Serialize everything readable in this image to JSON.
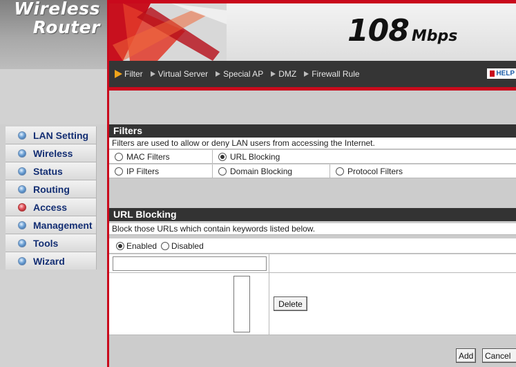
{
  "brand": {
    "line1": "Wireless",
    "line2": "Router"
  },
  "banner": {
    "speed_value": "108",
    "speed_unit": "Mbps"
  },
  "nav": {
    "items": [
      {
        "label": "Filter"
      },
      {
        "label": "Virtual Server"
      },
      {
        "label": "Special AP"
      },
      {
        "label": "DMZ"
      },
      {
        "label": "Firewall Rule"
      }
    ],
    "help_label": "HELP"
  },
  "sidebar": {
    "items": [
      {
        "label": "LAN Setting"
      },
      {
        "label": "Wireless"
      },
      {
        "label": "Status"
      },
      {
        "label": "Routing"
      },
      {
        "label": "Access",
        "active": true
      },
      {
        "label": "Management"
      },
      {
        "label": "Tools"
      },
      {
        "label": "Wizard"
      }
    ]
  },
  "filters": {
    "title": "Filters",
    "description": "Filters are used to allow or deny LAN users from accessing the Internet.",
    "options": [
      {
        "label": "MAC Filters",
        "selected": false
      },
      {
        "label": "URL Blocking",
        "selected": true
      },
      {
        "label": "IP Filters",
        "selected": false
      },
      {
        "label": "Domain Blocking",
        "selected": false
      },
      {
        "label": "Protocol Filters",
        "selected": false
      }
    ]
  },
  "url_blocking": {
    "title": "URL Blocking",
    "description": "Block those URLs which contain keywords listed below.",
    "enabled_label": "Enabled",
    "disabled_label": "Disabled",
    "enabled": true,
    "keyword_value": "",
    "delete_label": "Delete",
    "add_label": "Add",
    "cancel_label": "Cancel"
  },
  "colors": {
    "accent_red": "#c9091c",
    "nav_bg": "#353535",
    "menu_text": "#132e73",
    "section_bg": "#333333"
  }
}
